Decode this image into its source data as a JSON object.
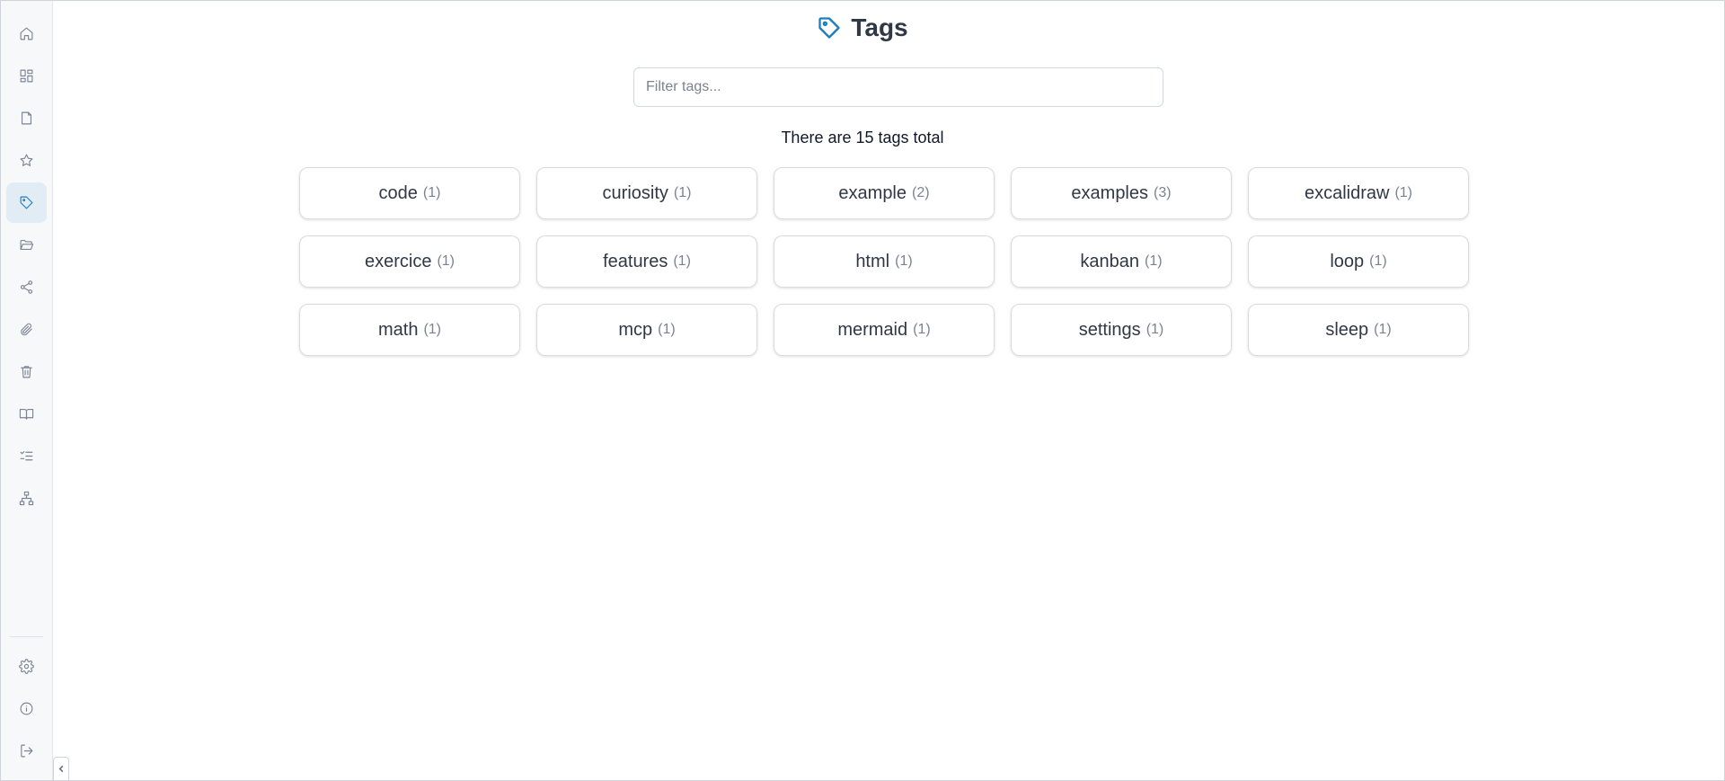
{
  "sidebar": {
    "top_items": [
      {
        "name": "home-icon",
        "active": false
      },
      {
        "name": "dashboard-icon",
        "active": false
      },
      {
        "name": "file-icon",
        "active": false
      },
      {
        "name": "star-icon",
        "active": false
      },
      {
        "name": "tag-icon",
        "active": true
      },
      {
        "name": "folder-open-icon",
        "active": false
      },
      {
        "name": "share-icon",
        "active": false
      },
      {
        "name": "paperclip-icon",
        "active": false
      },
      {
        "name": "trash-icon",
        "active": false
      },
      {
        "name": "book-open-icon",
        "active": false
      },
      {
        "name": "list-checks-icon",
        "active": false
      },
      {
        "name": "network-icon",
        "active": false
      }
    ],
    "bottom_items": [
      {
        "name": "gear-icon"
      },
      {
        "name": "info-icon"
      },
      {
        "name": "logout-icon"
      }
    ],
    "collapse_icon": "chevron-left-icon"
  },
  "header": {
    "icon": "tag-icon",
    "title": "Tags",
    "accent_color": "#1a7fc1"
  },
  "filter": {
    "placeholder": "Filter tags...",
    "value": ""
  },
  "summary": {
    "text": "There are 15 tags total"
  },
  "tags": [
    {
      "name": "code",
      "count": "(1)"
    },
    {
      "name": "curiosity",
      "count": "(1)"
    },
    {
      "name": "example",
      "count": "(2)"
    },
    {
      "name": "examples",
      "count": "(3)"
    },
    {
      "name": "excalidraw",
      "count": "(1)"
    },
    {
      "name": "exercice",
      "count": "(1)"
    },
    {
      "name": "features",
      "count": "(1)"
    },
    {
      "name": "html",
      "count": "(1)"
    },
    {
      "name": "kanban",
      "count": "(1)"
    },
    {
      "name": "loop",
      "count": "(1)"
    },
    {
      "name": "math",
      "count": "(1)"
    },
    {
      "name": "mcp",
      "count": "(1)"
    },
    {
      "name": "mermaid",
      "count": "(1)"
    },
    {
      "name": "settings",
      "count": "(1)"
    },
    {
      "name": "sleep",
      "count": "(1)"
    }
  ]
}
